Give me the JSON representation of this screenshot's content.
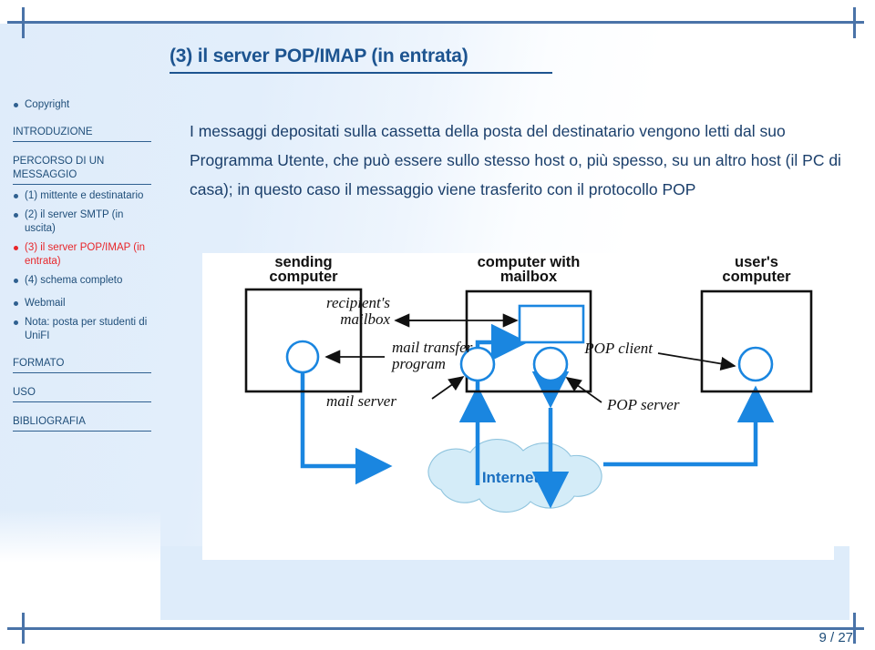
{
  "slide": {
    "title": "(3) il server POP/IMAP (in entrata)",
    "body": "I messaggi depositati sulla cassetta della posta del destinatario vengono letti dal suo Programma Utente, che può essere sullo stesso host o, più spesso, su un altro host (il PC di casa); in questo caso il messaggio viene trasferito con il protocollo POP",
    "page_number": "9 / 27"
  },
  "colors": {
    "accent_blue": "#1d5490",
    "nav_blue": "#1f4e79",
    "active_red": "#e8262a",
    "sidebar_tint": "#deecfa",
    "diagram_blue": "#1a86e0",
    "cloud_fill": "#d4ecf8"
  },
  "sidebar": {
    "items": [
      {
        "type": "bullet",
        "label": "Copyright",
        "active": false
      },
      {
        "type": "gap"
      },
      {
        "type": "section",
        "label": "INTRODUZIONE"
      },
      {
        "type": "gap"
      },
      {
        "type": "section",
        "label": "PERCORSO DI UN MESSAGGIO"
      },
      {
        "type": "bullet",
        "label": "(1) mittente e destinatario",
        "active": false
      },
      {
        "type": "bullet",
        "label": "(2) il server SMTP (in uscita)",
        "active": false
      },
      {
        "type": "bullet",
        "label": "(3) il server POP/IMAP (in entrata)",
        "active": true
      },
      {
        "type": "bullet",
        "label": "(4) schema completo",
        "active": false
      },
      {
        "type": "gap-sm"
      },
      {
        "type": "bullet",
        "label": "Webmail",
        "active": false
      },
      {
        "type": "bullet",
        "label": "Nota: posta per studenti di UniFI",
        "active": false
      },
      {
        "type": "gap"
      },
      {
        "type": "section",
        "label": "FORMATO"
      },
      {
        "type": "gap"
      },
      {
        "type": "section",
        "label": "USO"
      },
      {
        "type": "gap"
      },
      {
        "type": "section",
        "label": "BIBLIOGRAFIA"
      }
    ]
  },
  "figure": {
    "labels": {
      "sending_computer_line1": "sending",
      "sending_computer_line2": "computer",
      "computer_with_mailbox_line1": "computer with",
      "computer_with_mailbox_line2": "mailbox",
      "users_computer_line1": "user's",
      "users_computer_line2": "computer",
      "recipients_mailbox_line1": "recipient's",
      "recipients_mailbox_line2": "mailbox",
      "mail_transfer_line1": "mail transfer",
      "mail_transfer_line2": "program",
      "mail_server": "mail server",
      "pop_client": "POP client",
      "pop_server": "POP server",
      "internet": "Internet"
    }
  }
}
